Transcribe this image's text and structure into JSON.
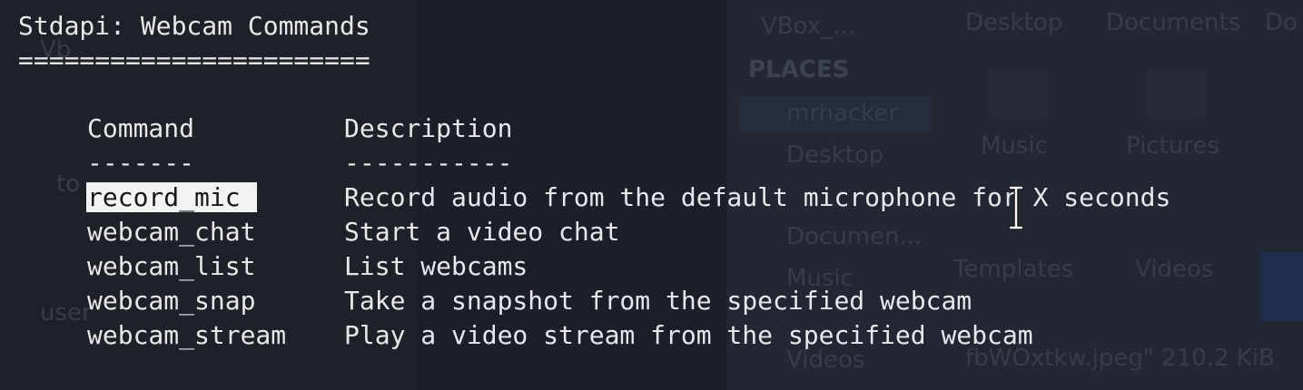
{
  "background": {
    "device_label": "VBox_...",
    "nav_items": [
      "Desktop",
      "Documents",
      "Do"
    ],
    "places_heading": "PLACES",
    "places_items": [
      "mrhacker",
      "Desktop",
      "Documen...",
      "Music",
      "Videos"
    ],
    "folders": [
      "Music",
      "Pictures",
      "Templates",
      "Videos"
    ],
    "file_status": "fbWOxtkw.jpeg\" 210.2 KiB",
    "left_fragments": [
      "Vb",
      "to",
      "user"
    ]
  },
  "terminal": {
    "title": "Stdapi: Webcam Commands",
    "title_underline": "=======================",
    "table": {
      "headers": {
        "command": "Command",
        "description": "Description"
      },
      "header_underlines": {
        "command": "-------",
        "description": "-----------"
      },
      "rows": [
        {
          "command": "record_mic",
          "description": "Record audio from the default microphone for X seconds",
          "selected": true
        },
        {
          "command": "webcam_chat",
          "description": "Start a video chat"
        },
        {
          "command": "webcam_list",
          "description": "List webcams"
        },
        {
          "command": "webcam_snap",
          "description": "Take a snapshot from the specified webcam"
        },
        {
          "command": "webcam_stream",
          "description": "Play a video stream from the specified webcam"
        }
      ]
    }
  },
  "colors": {
    "terminal_bg": "#1c1f27",
    "text": "#e8e8ec",
    "selection_bg": "#f2f2f2",
    "selection_text": "#15171d"
  },
  "cursor_icon": "ibeam-cursor-icon"
}
